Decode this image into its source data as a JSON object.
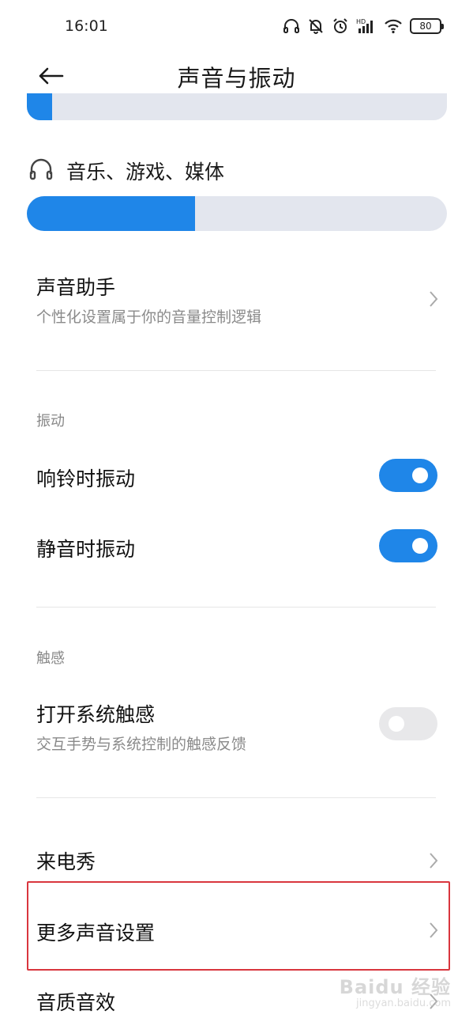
{
  "status_bar": {
    "time": "16:01",
    "battery": "80",
    "icons": [
      "headphones-icon",
      "mute-bell-icon",
      "alarm-icon",
      "hd-signal-icon",
      "wifi-icon",
      "battery-icon"
    ]
  },
  "nav": {
    "back_icon": "back-arrow-icon",
    "title": "声音与振动"
  },
  "volume": {
    "top_slider_level": 0.06,
    "media_label": "音乐、游戏、媒体",
    "media_icon": "headphones-icon",
    "media_level": 0.4
  },
  "sound_assistant": {
    "title": "声音助手",
    "subtitle": "个性化设置属于你的音量控制逻辑"
  },
  "vibration": {
    "header": "振动",
    "ring_vibrate_label": "响铃时振动",
    "ring_vibrate_on": true,
    "silent_vibrate_label": "静音时振动",
    "silent_vibrate_on": true
  },
  "haptics": {
    "header": "触感",
    "title": "打开系统触感",
    "subtitle": "交互手势与系统控制的触感反馈",
    "on": false
  },
  "menu": {
    "caller_show": "来电秀",
    "more_sound_settings": "更多声音设置",
    "sound_quality": "音质音效"
  },
  "watermark": {
    "top": "Baidu 经验",
    "bottom": "jingyan.baidu.com"
  },
  "colors": {
    "accent": "#1f86e8",
    "track": "#e3e6ee",
    "highlight": "#d9363e"
  }
}
